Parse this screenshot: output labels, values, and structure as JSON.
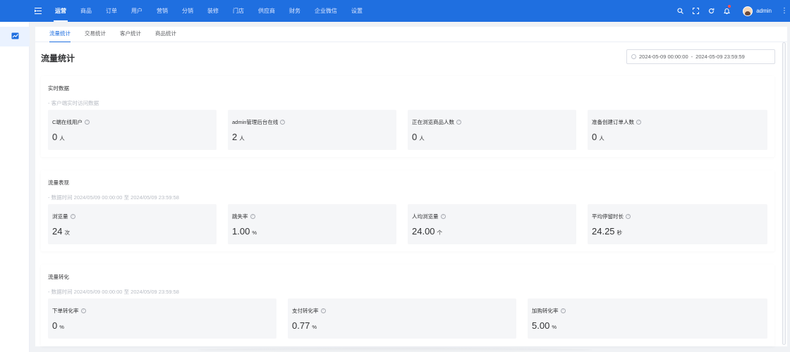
{
  "topbar": {
    "nav": [
      "运营",
      "商品",
      "订单",
      "用户",
      "营销",
      "分销",
      "装修",
      "门店",
      "供应商",
      "财务",
      "企业微信",
      "设置"
    ],
    "active_nav": "运营",
    "username": "admin",
    "icons": [
      "menu-fold-icon",
      "search-icon",
      "fullscreen-icon",
      "refresh-icon",
      "bell-icon",
      "more-icon"
    ]
  },
  "tabs": [
    "流量统计",
    "交易统计",
    "客户统计",
    "商品统计"
  ],
  "page_title": "流量统计",
  "date_range": {
    "start": "2024-05-09 00:00:00",
    "separator": "-",
    "end": "2024-05-09 23:59:59"
  },
  "sections": [
    {
      "title": "实时数据",
      "subtitle": "- 客户端实时访问数据",
      "stats": [
        {
          "label": "C端在线用户",
          "value": "0",
          "unit": "人"
        },
        {
          "label": "admin管理后台在线",
          "value": "2",
          "unit": "人"
        },
        {
          "label": "正在浏览商品人数",
          "value": "0",
          "unit": "人"
        },
        {
          "label": "准备创建订单人数",
          "value": "0",
          "unit": "人"
        }
      ]
    },
    {
      "title": "流量表现",
      "subtitle": "- 数据时间 2024/05/09 00:00:00 至 2024/05/09 23:59:58",
      "stats": [
        {
          "label": "浏览量",
          "value": "24",
          "unit": "次"
        },
        {
          "label": "跳失率",
          "value": "1.00",
          "unit": "%"
        },
        {
          "label": "人均浏览量",
          "value": "24.00",
          "unit": "个"
        },
        {
          "label": "平均停留时长",
          "value": "24.25",
          "unit": "秒"
        }
      ]
    },
    {
      "title": "流量转化",
      "subtitle": "- 数据时间 2024/05/09 00:00:00 至 2024/05/09 23:59:58",
      "stats": [
        {
          "label": "下单转化率",
          "value": "0",
          "unit": "%"
        },
        {
          "label": "支付转化率",
          "value": "0.77",
          "unit": "%"
        },
        {
          "label": "加购转化率",
          "value": "5.00",
          "unit": "%"
        }
      ]
    }
  ],
  "colors": {
    "primary": "#1f6fe0",
    "card_bg": "#f5f6f8",
    "page_bg": "#f0f2f5"
  }
}
